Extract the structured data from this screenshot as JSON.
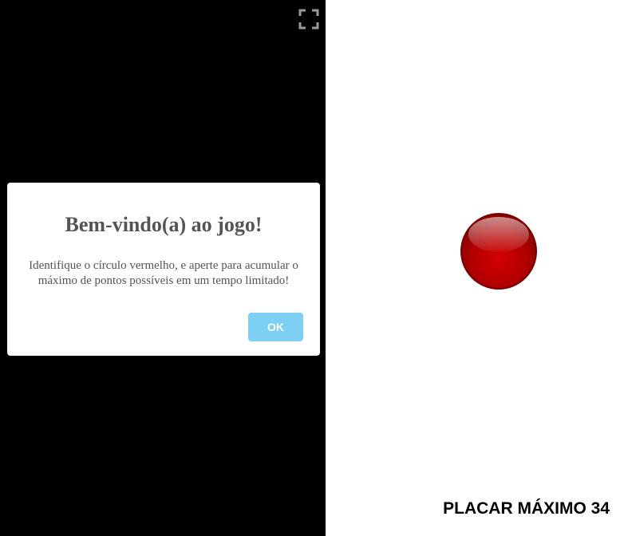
{
  "dialog": {
    "title": "Bem-vindo(a) ao jogo!",
    "message": "Identifique o círculo vermelho, e aperte para acumular o máximo de pontos possíveis em um tempo limitado!",
    "ok_label": "OK"
  },
  "score": {
    "high_score_label": "PLACAR MÁXIMO",
    "high_score_value": "34"
  },
  "icons": {
    "fullscreen": "fullscreen-icon",
    "target": "red-circle-target"
  },
  "colors": {
    "left_background": "#000000",
    "right_background": "#ffffff",
    "ok_button": "#7ecff4",
    "dialog_text": "#545454",
    "target_red": "#c00000"
  }
}
